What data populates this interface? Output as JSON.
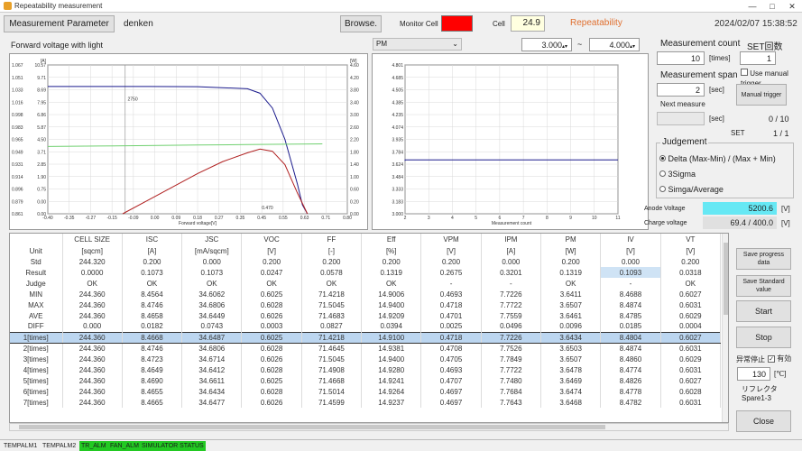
{
  "window": {
    "title": "Repeatability measurement",
    "min": "—",
    "max": "□",
    "close": "✕"
  },
  "header": {
    "param_button": "Measurement Parameter",
    "param_name": "denken",
    "browse": "Browse.",
    "monitor_cell_label": "Monitor Cell",
    "monitor_color": "#ff0000",
    "cell_label": "Cell",
    "cell_value": "24.9",
    "mode_label": "Repeatability",
    "datetime": "2024/02/07 15:38:52"
  },
  "chart_top": {
    "title": "Forward voltage with light",
    "select_value": "PM",
    "range_min": "3.000",
    "range_sep": "~",
    "range_max": "4.000"
  },
  "chart_data": [
    {
      "type": "line",
      "title": "Forward voltage with light",
      "xlabel": "Forward voltage[V]",
      "x_ticks": [
        "-0.40",
        "-0.35",
        "-0.27",
        "-0.15",
        "-0.09",
        "0.00",
        "0.09",
        "0.18",
        "0.27",
        "0.35",
        "0.45",
        "0.55",
        "0.63",
        "0.71",
        "0.80"
      ],
      "y_left_ticks": [
        "10.57",
        "9.71",
        "8.69",
        "7.95",
        "6.86",
        "5.87",
        "4.50",
        "3.71",
        "2.85",
        "1.90",
        "0.75",
        "0.00",
        "0.00"
      ],
      "y_left_unit": "[A]",
      "y_right_ticks": [
        "4.60",
        "4.20",
        "3.80",
        "3.40",
        "3.00",
        "2.60",
        "2.20",
        "1.80",
        "1.40",
        "1.00",
        "0.60",
        "0.20",
        "0.00"
      ],
      "y_right_unit": "[W]",
      "y_left_edge_ticks": [
        "1.067",
        "1.051",
        "1.033",
        "1.016",
        "0.998",
        "0.983",
        "0.965",
        "0.949",
        "0.931",
        "0.914",
        "0.896",
        "0.879",
        "0.861"
      ],
      "annotations": [
        "2750",
        "0.470"
      ],
      "series": [
        {
          "color": "#1a1a8c",
          "x": [
            -0.4,
            0.0,
            0.2,
            0.4,
            0.45,
            0.5,
            0.55,
            0.6,
            0.62,
            0.64
          ],
          "y": [
            8.55,
            8.55,
            8.54,
            8.4,
            8.1,
            7.1,
            5.0,
            2.0,
            0.6,
            0.0
          ]
        },
        {
          "color": "#b02020",
          "x": [
            -0.1,
            0.0,
            0.1,
            0.2,
            0.3,
            0.4,
            0.45,
            0.5,
            0.55,
            0.6,
            0.64
          ],
          "y": [
            0.0,
            0.9,
            1.8,
            2.7,
            3.5,
            4.1,
            4.35,
            4.2,
            3.3,
            1.4,
            0.0
          ]
        },
        {
          "color": "#70d070",
          "x": [
            -0.4,
            -0.2,
            0.0,
            0.2,
            0.4,
            0.6,
            0.7
          ],
          "y": [
            4.52,
            4.55,
            4.58,
            4.62,
            4.65,
            4.68,
            4.7
          ]
        }
      ]
    },
    {
      "type": "line",
      "xlabel": "Measurement count",
      "x_ticks": [
        "2",
        "3",
        "4",
        "5",
        "6",
        "7",
        "8",
        "9",
        "10",
        "11"
      ],
      "y_left_ticks": [
        "4.801",
        "4.685",
        "4.505",
        "4.385",
        "4.235",
        "4.074",
        "3.935",
        "3.784",
        "3.624",
        "3.484",
        "3.333",
        "3.183",
        "3.000"
      ],
      "series": [
        {
          "color": "#1a1a8c",
          "x": [
            1,
            2,
            3,
            4,
            5,
            6,
            7,
            8,
            9,
            10,
            11
          ],
          "y": [
            3.641,
            3.652,
            3.652,
            3.652,
            3.652,
            3.652,
            3.652,
            3.652,
            3.652,
            3.652,
            3.652
          ]
        }
      ]
    }
  ],
  "right_panel": {
    "count_label": "Measurement count",
    "count_value": "10",
    "count_unit": "[times]",
    "set_label": "SET回数",
    "set_value": "1",
    "manual_trigger_chk": "Use manual trigger",
    "span_label": "Measurement span",
    "span_value": "2",
    "span_unit": "[sec]",
    "manual_trigger_btn": "Manual trigger",
    "next_label": "Next measure",
    "next_unit": "[sec]",
    "progress": "0 / 10",
    "set_progress_label": "SET",
    "set_progress": "1 / 1",
    "judgement_title": "Judgement",
    "judge_opts": [
      "Delta (Max-Min) / (Max + Min)",
      "3Sigma",
      "Simga/Average"
    ],
    "anode_label": "Anode Voltage",
    "anode_value": "5200.6",
    "anode_unit": "[V]",
    "charge_label": "Charge voltage",
    "charge_value": "69.4 / 400.0",
    "charge_unit": "[V]"
  },
  "table": {
    "columns": [
      "",
      "CELL SIZE",
      "ISC",
      "JSC",
      "VOC",
      "FF",
      "Eff",
      "VPM",
      "IPM",
      "PM",
      "IV",
      "VT"
    ],
    "rows": [
      [
        "Unit",
        "[sqcm]",
        "[A]",
        "[mA/sqcm]",
        "[V]",
        "[-]",
        "[%]",
        "[V]",
        "[A]",
        "[W]",
        "[V]",
        "[V]"
      ],
      [
        "Std",
        "244.320",
        "0.200",
        "0.000",
        "0.200",
        "0.200",
        "0.200",
        "0.200",
        "0.000",
        "0.200",
        "0.000",
        "0.200"
      ],
      [
        "Result",
        "0.0000",
        "0.1073",
        "0.1073",
        "0.0247",
        "0.0578",
        "0.1319",
        "0.2675",
        "0.3201",
        "0.1319",
        "0.1093",
        "0.0318"
      ],
      [
        "Judge",
        "OK",
        "OK",
        "OK",
        "OK",
        "OK",
        "OK",
        "-",
        "-",
        "OK",
        "-",
        "OK"
      ],
      [
        "MIN",
        "244.360",
        "8.4564",
        "34.6062",
        "0.6025",
        "71.4218",
        "14.9006",
        "0.4693",
        "7.7226",
        "3.6411",
        "8.4688",
        "0.6027"
      ],
      [
        "MAX",
        "244.360",
        "8.4746",
        "34.6806",
        "0.6028",
        "71.5045",
        "14.9400",
        "0.4718",
        "7.7722",
        "3.6507",
        "8.4874",
        "0.6031"
      ],
      [
        "AVE",
        "244.360",
        "8.4658",
        "34.6449",
        "0.6026",
        "71.4683",
        "14.9209",
        "0.4701",
        "7.7559",
        "3.6461",
        "8.4785",
        "0.6029"
      ],
      [
        "DIFF",
        "0.000",
        "0.0182",
        "0.0743",
        "0.0003",
        "0.0827",
        "0.0394",
        "0.0025",
        "0.0496",
        "0.0096",
        "0.0185",
        "0.0004"
      ],
      [
        "1[times]",
        "244.360",
        "8.4668",
        "34.6487",
        "0.6025",
        "71.4218",
        "14.9100",
        "0.4718",
        "7.7226",
        "3.6434",
        "8.4804",
        "0.6027"
      ],
      [
        "2[times]",
        "244.360",
        "8.4746",
        "34.6806",
        "0.6028",
        "71.4645",
        "14.9381",
        "0.4708",
        "7.7526",
        "3.6503",
        "8.4874",
        "0.6031"
      ],
      [
        "3[times]",
        "244.360",
        "8.4723",
        "34.6714",
        "0.6026",
        "71.5045",
        "14.9400",
        "0.4705",
        "7.7849",
        "3.6507",
        "8.4860",
        "0.6029"
      ],
      [
        "4[times]",
        "244.360",
        "8.4649",
        "34.6412",
        "0.6028",
        "71.4908",
        "14.9280",
        "0.4693",
        "7.7722",
        "3.6478",
        "8.4774",
        "0.6031"
      ],
      [
        "5[times]",
        "244.360",
        "8.4690",
        "34.6611",
        "0.6025",
        "71.4668",
        "14.9241",
        "0.4707",
        "7.7480",
        "3.6469",
        "8.4826",
        "0.6027"
      ],
      [
        "6[times]",
        "244.360",
        "8.4655",
        "34.6434",
        "0.6028",
        "71.5014",
        "14.9264",
        "0.4697",
        "7.7684",
        "3.6474",
        "8.4778",
        "0.6028"
      ],
      [
        "7[times]",
        "244.360",
        "8.4665",
        "34.6477",
        "0.6026",
        "71.4599",
        "14.9237",
        "0.4697",
        "7.7643",
        "3.6468",
        "8.4782",
        "0.6031"
      ]
    ]
  },
  "side_buttons": {
    "save_progress": "Save progress data",
    "save_std": "Save Standard value",
    "start": "Start",
    "stop": "Stop",
    "auto_stop": "异常停止",
    "enable_label": "有効",
    "temp_value": "130",
    "temp_unit": "[℃]",
    "reflector": "リフレクタ",
    "spare": "Spare1-3",
    "close": "Close"
  },
  "statusbar": [
    {
      "label": "TEMPALM1",
      "color": "#f0f0f0",
      "text": "#222"
    },
    {
      "label": "TEMPALM2",
      "color": "#f0f0f0",
      "text": "#222"
    },
    {
      "label": "TR_ALM",
      "color": "#22c922",
      "text": "#1a1a1a"
    },
    {
      "label": "FAN_ALM",
      "color": "#22c922",
      "text": "#1a1a1a"
    },
    {
      "label": "SIMULATOR STATUS",
      "color": "#22c922",
      "text": "#1a1a1a"
    }
  ]
}
